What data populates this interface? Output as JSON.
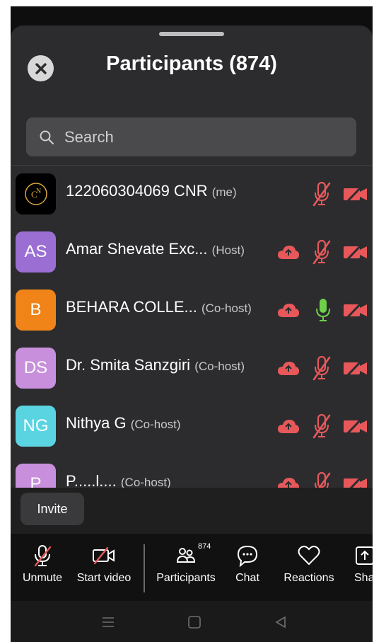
{
  "header": {
    "title": "Participants (874)"
  },
  "search": {
    "placeholder": "Search"
  },
  "participants": [
    {
      "avatar_text": "",
      "avatar_color": "#000000",
      "name": "122060304069 CNR",
      "role": "(me)",
      "cloud": false,
      "mic": "muted",
      "video": "off"
    },
    {
      "avatar_text": "AS",
      "avatar_color": "#9b6ed3",
      "name": "Amar Shevate Exc...",
      "role": "(Host)",
      "cloud": true,
      "mic": "muted",
      "video": "off"
    },
    {
      "avatar_text": "B",
      "avatar_color": "#f08418",
      "name": "BEHARA COLLE...",
      "role": "(Co-host)",
      "cloud": true,
      "mic": "on",
      "video": "off"
    },
    {
      "avatar_text": "DS",
      "avatar_color": "#c88fdc",
      "name": "Dr. Smita Sanzgiri",
      "role": "(Co-host)",
      "cloud": true,
      "mic": "muted",
      "video": "off"
    },
    {
      "avatar_text": "NG",
      "avatar_color": "#5bd4e2",
      "name": "Nithya G",
      "role": "(Co-host)",
      "cloud": true,
      "mic": "muted",
      "video": "off"
    },
    {
      "avatar_text": "P",
      "avatar_color": "#c88fdc",
      "name": "P.....l....",
      "role": "(Co-host)",
      "cloud": true,
      "mic": "muted",
      "video": "off"
    }
  ],
  "invite": {
    "label": "Invite"
  },
  "toolbar": {
    "unmute": "Unmute",
    "start_video": "Start video",
    "participants": "Participants",
    "participants_count": "874",
    "chat": "Chat",
    "reactions": "Reactions",
    "share": "Sha"
  },
  "colors": {
    "mute_red": "#e8585a",
    "mic_green": "#6ed04a",
    "sheet": "#2c2c2e"
  }
}
